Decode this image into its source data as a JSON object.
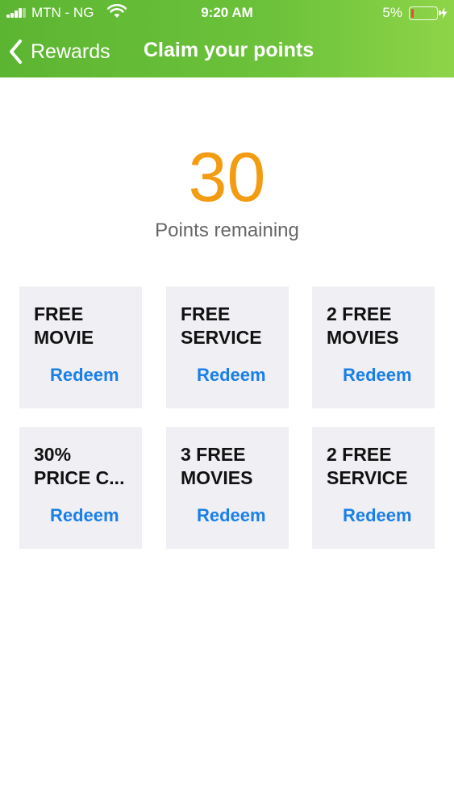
{
  "status_bar": {
    "carrier": "MTN - NG",
    "time": "9:20 AM",
    "battery_percent": "5%",
    "battery_level": 0.05
  },
  "nav": {
    "back_label": "Rewards",
    "title": "Claim your points"
  },
  "points": {
    "value": "30",
    "label": "Points remaining"
  },
  "rewards": [
    {
      "title": "FREE\nMOVIE",
      "action": "Redeem"
    },
    {
      "title": "FREE\nSERVICE",
      "action": "Redeem"
    },
    {
      "title": "2 FREE\nMOVIES",
      "action": "Redeem"
    },
    {
      "title": "30%\nPRICE C...",
      "action": "Redeem"
    },
    {
      "title": "3 FREE\nMOVIES",
      "action": "Redeem"
    },
    {
      "title": "2 FREE\nSERVICE",
      "action": "Redeem"
    }
  ],
  "colors": {
    "header_green": "#6cc23a",
    "points_orange": "#f39c12",
    "link_blue": "#1a7fe6",
    "card_bg": "#efeff4"
  },
  "icons": {
    "signal": "cellular-signal-icon",
    "wifi": "wifi-icon",
    "battery": "battery-icon",
    "charging": "charging-bolt-icon",
    "back": "chevron-left-icon"
  }
}
